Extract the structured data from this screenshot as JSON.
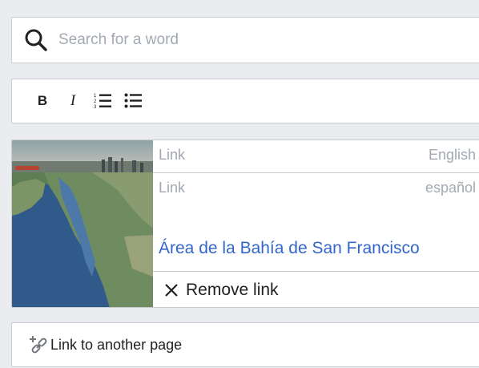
{
  "search": {
    "placeholder": "Search for a word",
    "icon": "search-icon"
  },
  "toolbar": {
    "bold_label": "B",
    "italic_label": "I",
    "icons": [
      "numbered-list-icon",
      "bullet-list-icon"
    ]
  },
  "link_card": {
    "thumbnail": "san-francisco-bay-area-satellite-image",
    "rows": [
      {
        "label": "Link",
        "language": "English"
      },
      {
        "label": "Link",
        "language": "español",
        "title": "Área de la Bahía de San Francisco"
      }
    ],
    "remove_label": "Remove link"
  },
  "link_another": {
    "label": "Link to another page",
    "icon": "add-link-icon"
  },
  "colors": {
    "link": "#3366cc",
    "muted": "#a2a9b1",
    "text": "#202122",
    "border": "#c8ccd1",
    "background": "#eaecf0"
  }
}
